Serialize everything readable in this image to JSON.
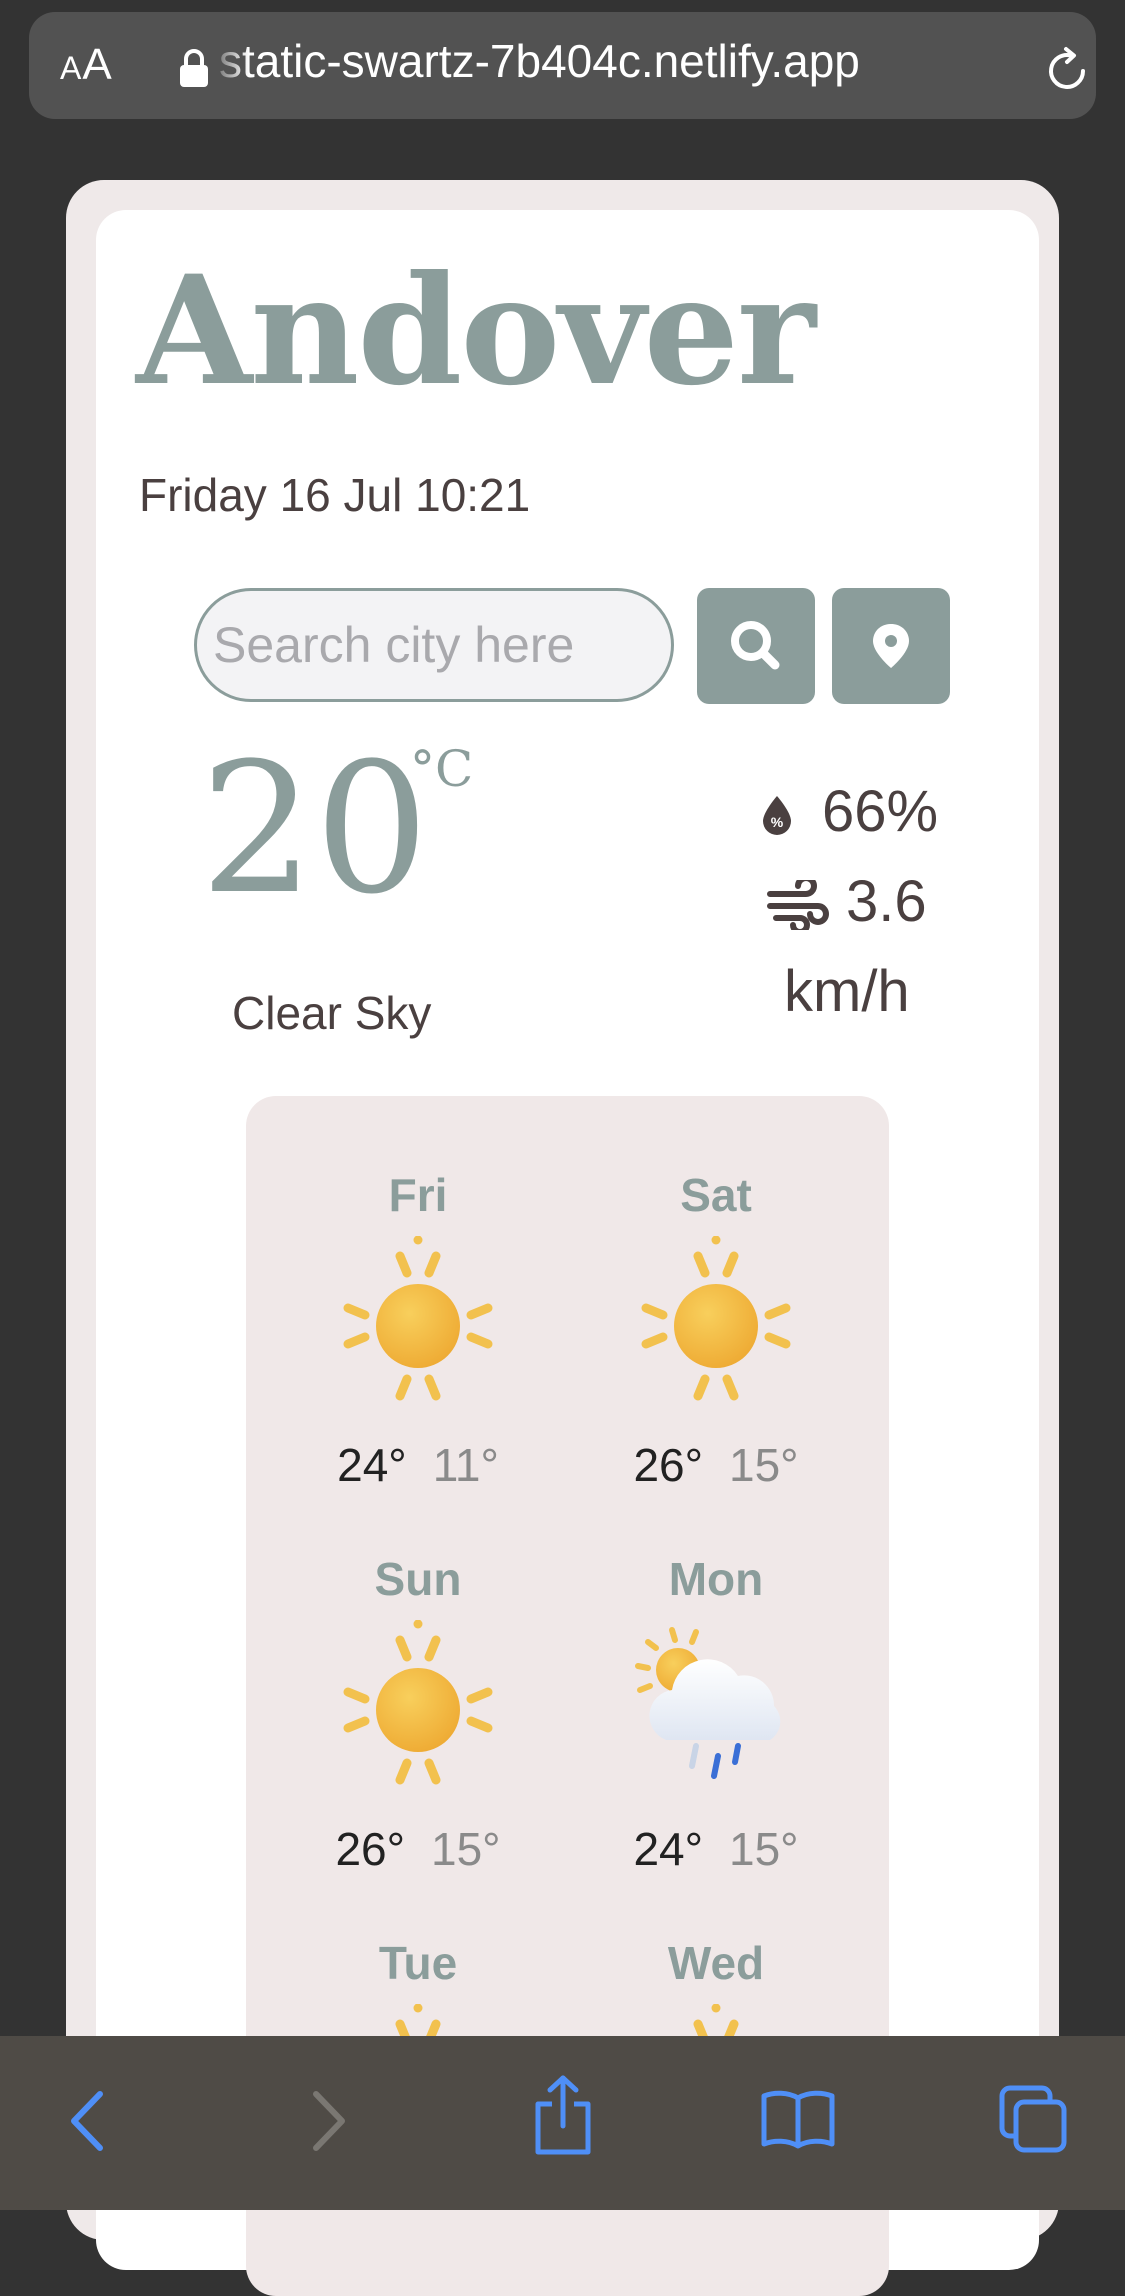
{
  "browser": {
    "text_size_label_small": "A",
    "text_size_label_large": "A",
    "url": "static-swartz-7b404c.netlify.app"
  },
  "weather": {
    "city": "Andover",
    "datetime": "Friday 16 Jul 10:21",
    "search_placeholder": "Search city here",
    "temperature": "20",
    "unit": "°C",
    "description": "Clear Sky",
    "humidity": "66%",
    "wind": "3.6",
    "wind_unit": "km/h",
    "forecast": [
      {
        "day": "Fri",
        "icon": "sun-icon",
        "max": "24°",
        "min": "11°"
      },
      {
        "day": "Sat",
        "icon": "sun-icon",
        "max": "26°",
        "min": "15°"
      },
      {
        "day": "Sun",
        "icon": "sun-icon",
        "max": "26°",
        "min": "15°"
      },
      {
        "day": "Mon",
        "icon": "sun-rain-cloud-icon",
        "max": "24°",
        "min": "15°"
      },
      {
        "day": "Tue",
        "icon": "sun-icon"
      },
      {
        "day": "Wed",
        "icon": "sun-icon"
      }
    ]
  },
  "colors": {
    "accent": "#8b9d9b",
    "sun": "#f2b740",
    "toolbar_icon": "#4f8ff7"
  }
}
